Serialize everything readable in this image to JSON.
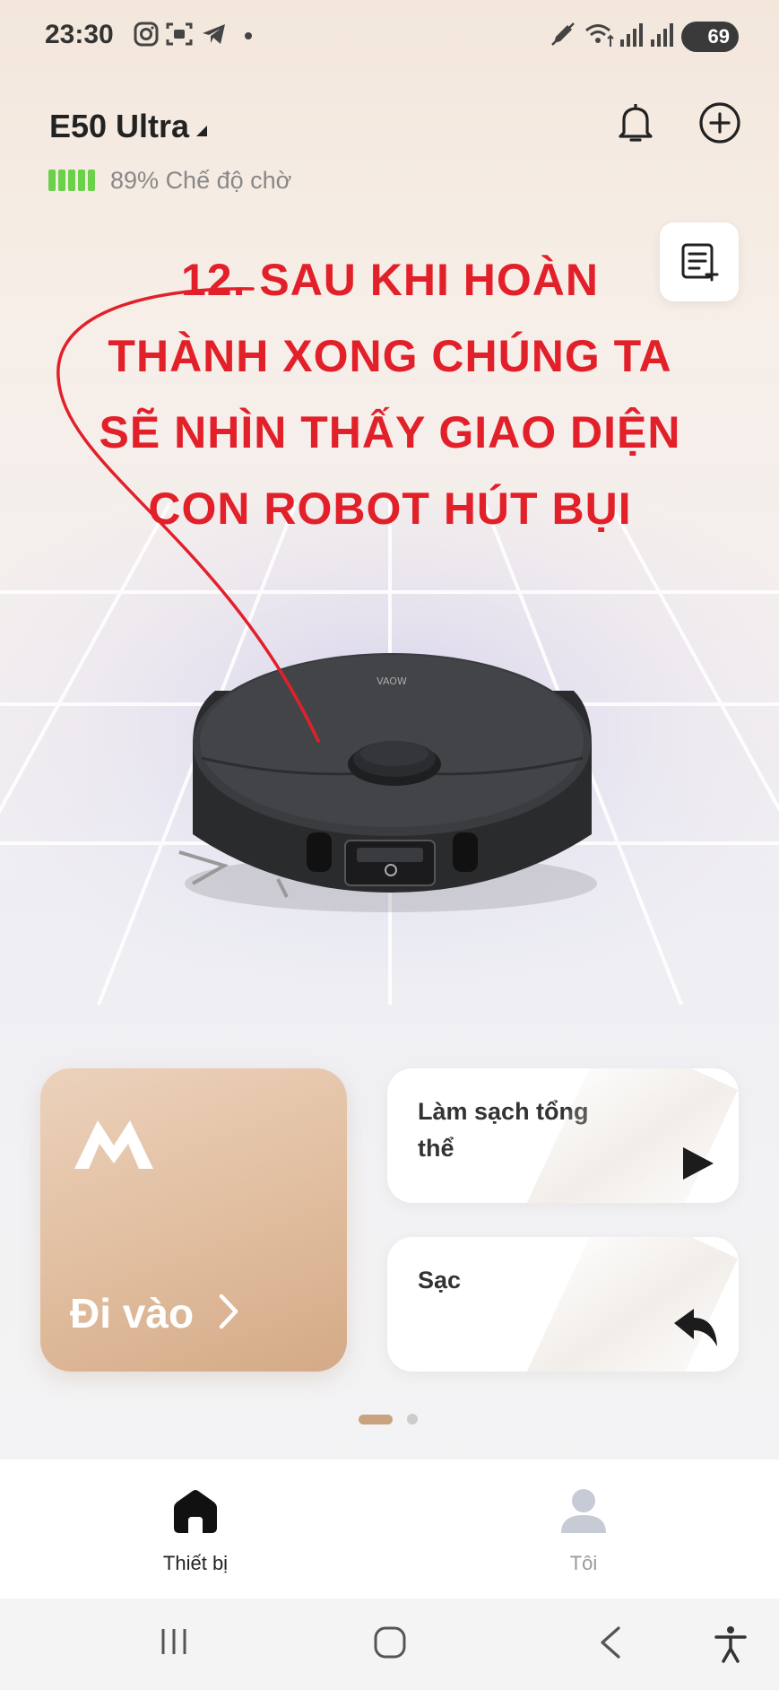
{
  "status_bar": {
    "time": "23:30",
    "battery_level": "69"
  },
  "header": {
    "device_name": "E50 Ultra",
    "battery_percent": "89%",
    "mode": "Chế độ chờ",
    "battery_bar_count": 5
  },
  "annotation": {
    "lines": [
      "12. SAU KHI HOÀN",
      "THÀNH XONG CHÚNG TA",
      "SẼ NHÌN THẤY GIAO DIỆN",
      "CON ROBOT HÚT BỤI"
    ],
    "color": "#e2202a"
  },
  "robot": {
    "brand_text": "VAOW"
  },
  "cards": {
    "enter_label": "Đi vào",
    "clean_all_label": "Làm sạch tổng thể",
    "charge_label": "Sạc"
  },
  "pager": {
    "current": 1,
    "total": 2
  },
  "bottom_nav": {
    "items": [
      {
        "label": "Thiết bị",
        "icon": "home-icon",
        "active": true
      },
      {
        "label": "Tôi",
        "icon": "user-icon",
        "active": false
      }
    ]
  },
  "colors": {
    "accent": "#c9a380",
    "battery_green": "#6bd04a",
    "card_gradient_start": "#ecd2bc",
    "card_gradient_end": "#d4aa87"
  }
}
